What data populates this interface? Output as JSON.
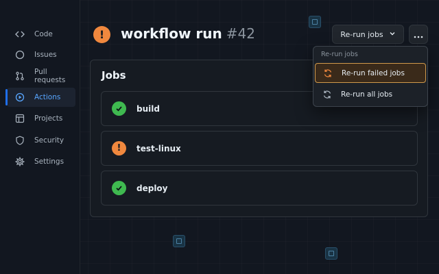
{
  "sidebar": {
    "items": [
      {
        "label": "Code",
        "icon": "code-icon"
      },
      {
        "label": "Issues",
        "icon": "issue-circle-icon"
      },
      {
        "label": "Pull requests",
        "icon": "pull-request-icon"
      },
      {
        "label": "Actions",
        "icon": "play-icon",
        "active": true
      },
      {
        "label": "Projects",
        "icon": "table-icon"
      },
      {
        "label": "Security",
        "icon": "shield-icon"
      },
      {
        "label": "Settings",
        "icon": "gear-icon"
      }
    ]
  },
  "header": {
    "title": "workflow run",
    "run_number": "#42",
    "status": "warning",
    "rerun_button": "Re-run jobs"
  },
  "jobs_panel": {
    "title": "Jobs",
    "jobs": [
      {
        "name": "build",
        "status": "success"
      },
      {
        "name": "test-linux",
        "status": "warning"
      },
      {
        "name": "deploy",
        "status": "success"
      }
    ]
  },
  "rerun_menu": {
    "header": "Re-run jobs",
    "items": [
      {
        "label": "Re-run failed jobs",
        "highlighted": true
      },
      {
        "label": "Re-run all jobs",
        "highlighted": false
      }
    ]
  },
  "colors": {
    "accent": "#58a6ff",
    "success": "#3fb950",
    "warning": "#f0883e"
  }
}
